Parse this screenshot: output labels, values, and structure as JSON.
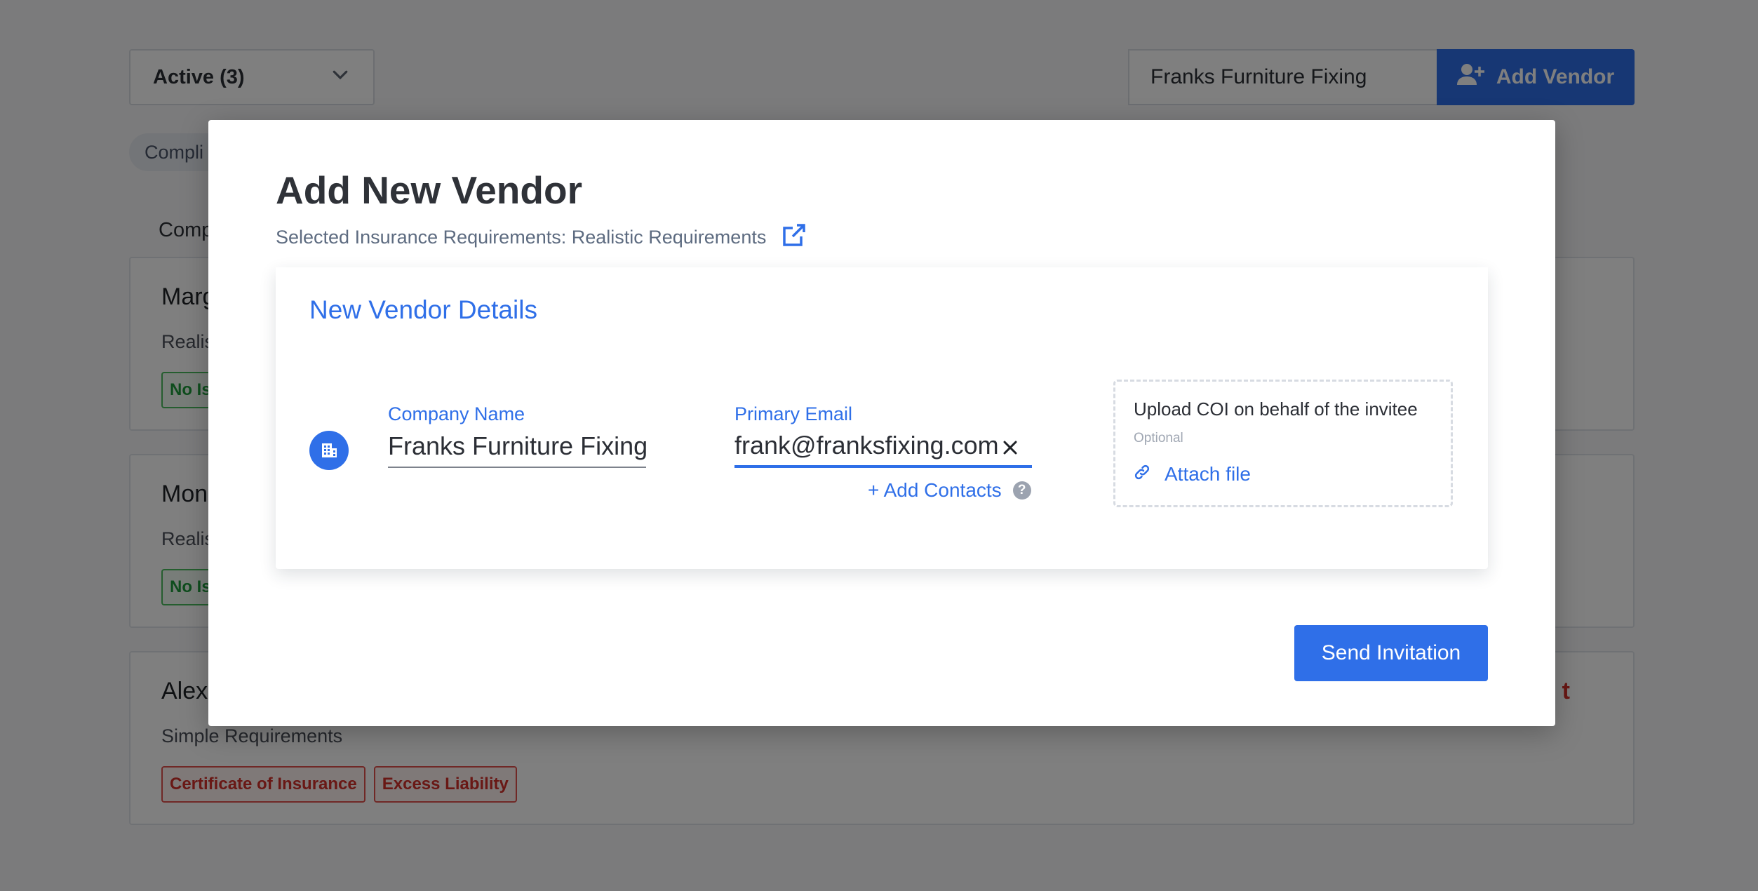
{
  "colors": {
    "accent": "#2f6fe8",
    "overlay": "rgba(0,0,0,0.5)",
    "compliant_green": "#1d9a3b",
    "noncompliant_red": "#d2302b"
  },
  "background": {
    "status_filter": {
      "value": "Active (3)",
      "icon": "chevron-down-icon"
    },
    "search": {
      "value": "Franks Furniture Fixing"
    },
    "add_vendor_button": {
      "label": "Add Vendor",
      "icon": "user-plus-icon"
    },
    "filter_chip": {
      "label": "Compli"
    },
    "column_header": "Comp",
    "vendors": [
      {
        "name": "Marg",
        "requirements": "Realis",
        "tags": [
          {
            "label": "No Is",
            "status": "green"
          }
        ],
        "status": ""
      },
      {
        "name": "Mon",
        "requirements": "Realis",
        "tags": [
          {
            "label": "No Is",
            "status": "green"
          }
        ],
        "status": ""
      },
      {
        "name": "Alex",
        "requirements": "Simple Requirements",
        "tags": [
          {
            "label": "Certificate of Insurance",
            "status": "red"
          },
          {
            "label": "Excess Liability",
            "status": "red"
          }
        ],
        "status": "t"
      }
    ]
  },
  "modal": {
    "title": "Add New Vendor",
    "requirements_line": "Selected Insurance Requirements: Realistic Requirements",
    "requirements_link_icon": "external-link-icon",
    "details": {
      "title": "New Vendor Details",
      "company_icon": "building-icon",
      "company_name": {
        "label": "Company Name",
        "value": "Franks Furniture Fixing"
      },
      "primary_email": {
        "label": "Primary Email",
        "value": "frank@franksfixing.com",
        "clear_icon": "close-icon"
      },
      "add_contacts": {
        "label": "+ Add Contacts",
        "help_icon": "question-icon",
        "help_glyph": "?"
      },
      "upload": {
        "title": "Upload COI on behalf of the invitee",
        "optional": "Optional",
        "attach_label": "Attach file",
        "attach_icon": "link-icon"
      }
    },
    "send_button": "Send Invitation"
  }
}
